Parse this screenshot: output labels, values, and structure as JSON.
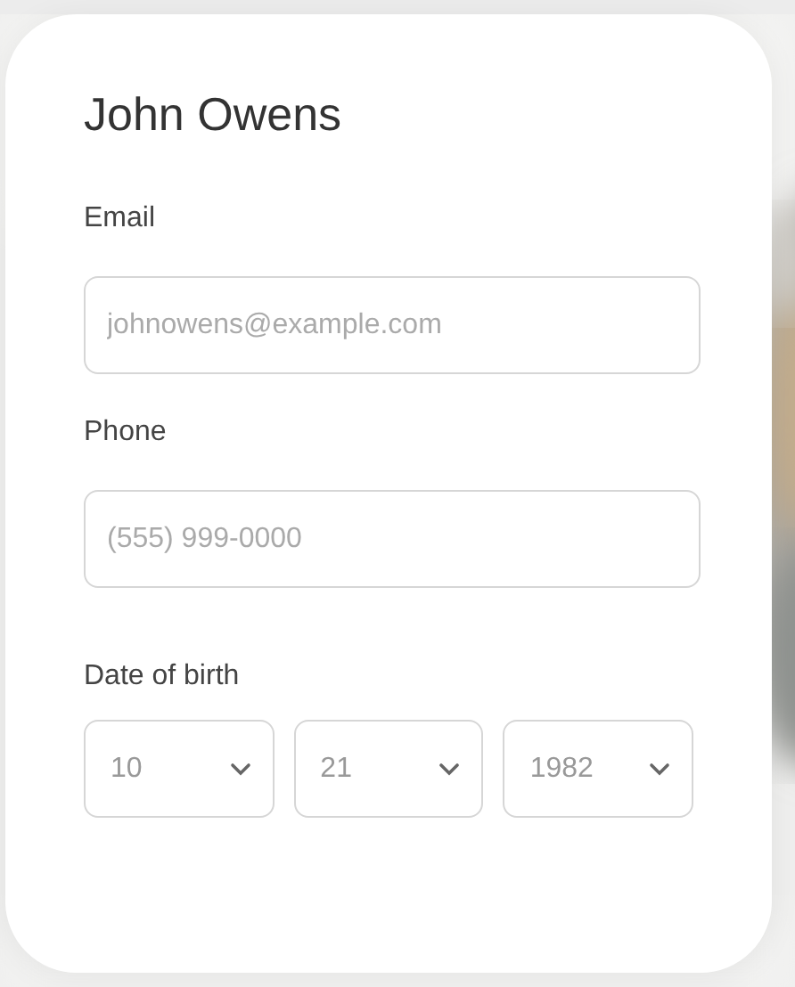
{
  "title": "John Owens",
  "fields": [
    {
      "label": "Email",
      "placeholder": "johnowens@example.com"
    },
    {
      "label": "Phone",
      "placeholder": "(555) 999-0000"
    }
  ],
  "date_of_birth": {
    "label": "Date of birth",
    "selects": [
      {
        "value": "10"
      },
      {
        "value": "21"
      },
      {
        "value": "1982"
      }
    ]
  }
}
